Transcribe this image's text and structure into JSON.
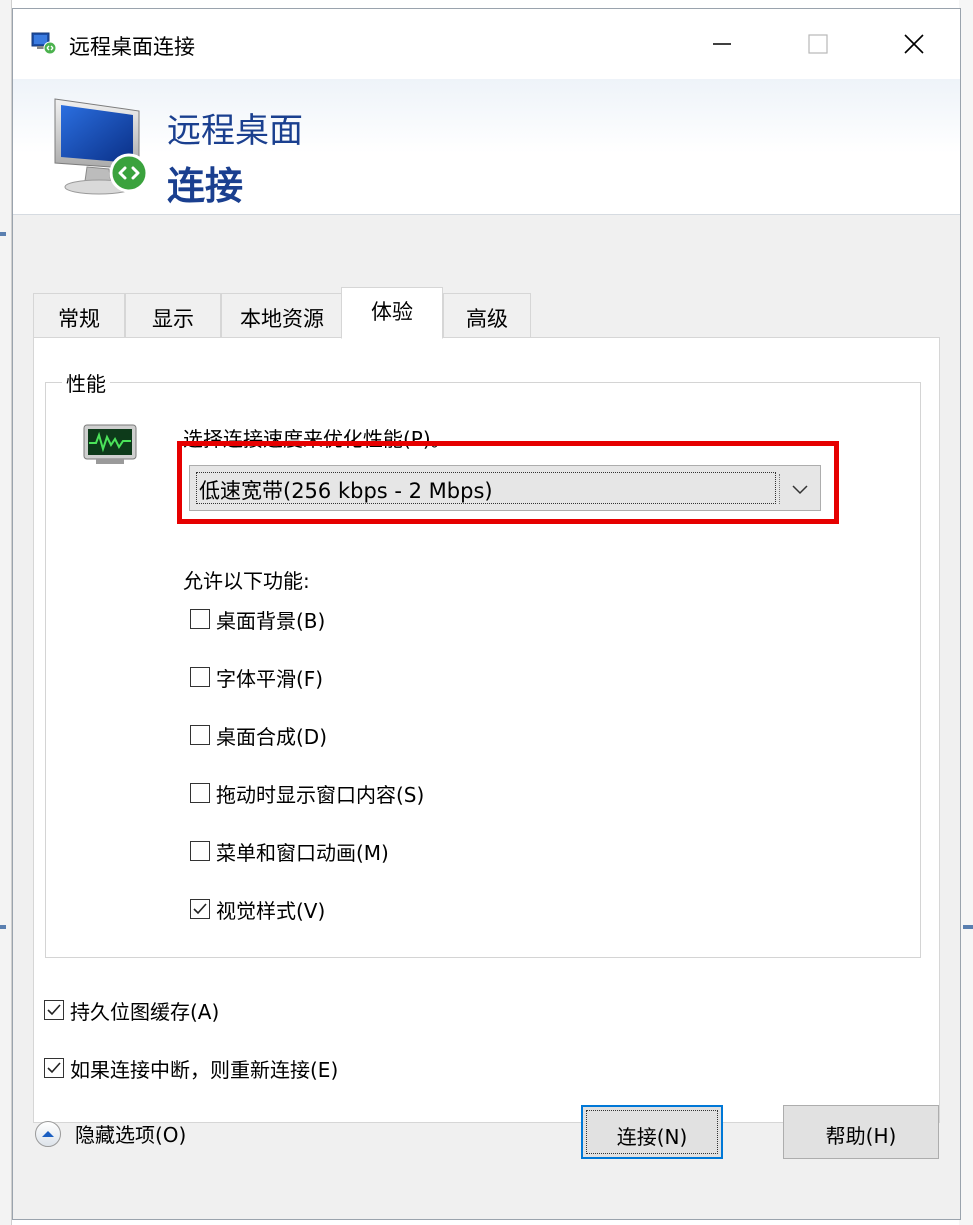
{
  "window": {
    "title": "远程桌面连接",
    "controls": {
      "minimize": "minimize",
      "maximize": "maximize",
      "close": "close"
    }
  },
  "banner": {
    "line1": "远程桌面",
    "line2": "连接"
  },
  "tabs": [
    {
      "label": "常规",
      "active": false
    },
    {
      "label": "显示",
      "active": false
    },
    {
      "label": "本地资源",
      "active": false
    },
    {
      "label": "体验",
      "active": true
    },
    {
      "label": "高级",
      "active": false
    }
  ],
  "performance": {
    "group_label": "性能",
    "speed_label": "选择连接速度来优化性能(P)。",
    "speed_value": "低速宽带(256 kbps - 2 Mbps)",
    "allow_label": "允许以下功能:",
    "features": [
      {
        "label": "桌面背景(B)",
        "checked": false
      },
      {
        "label": "字体平滑(F)",
        "checked": false
      },
      {
        "label": "桌面合成(D)",
        "checked": false
      },
      {
        "label": "拖动时显示窗口内容(S)",
        "checked": false
      },
      {
        "label": "菜单和窗口动画(M)",
        "checked": false
      },
      {
        "label": "视觉样式(V)",
        "checked": true
      }
    ]
  },
  "options": [
    {
      "label": "持久位图缓存(A)",
      "checked": true
    },
    {
      "label": "如果连接中断，则重新连接(E)",
      "checked": true
    }
  ],
  "footer": {
    "hide_options": "隐藏选项(O)",
    "connect": "连接(N)",
    "help": "帮助(H)"
  },
  "colors": {
    "banner_text": "#1a3f8f",
    "highlight": "#e60000",
    "focus_border": "#0078d7"
  }
}
